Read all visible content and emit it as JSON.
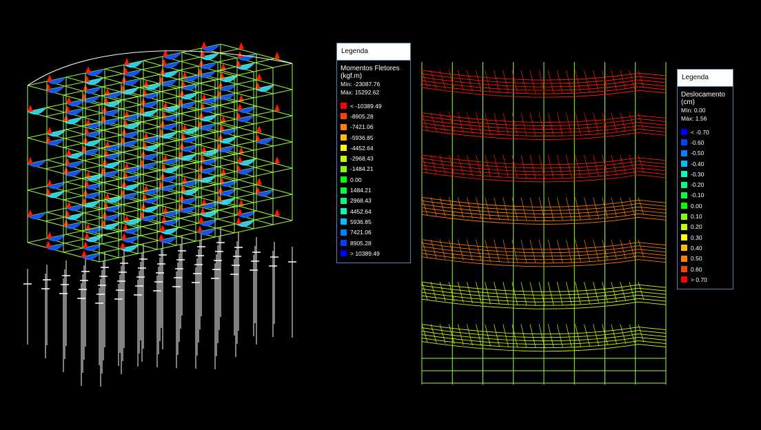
{
  "legend_momentos": {
    "header": "Legenda",
    "title": "Momentos Fletores\n(kgf.m)",
    "min": "Mín: -23087.76",
    "max": "Máx: 15292.62",
    "items": [
      {
        "label": "< -10389.49",
        "color": "#ff0000"
      },
      {
        "label": "-8905.28",
        "color": "#ff4000"
      },
      {
        "label": "-7421.06",
        "color": "#ff8000"
      },
      {
        "label": "-5936.85",
        "color": "#ffbf00"
      },
      {
        "label": "-4452.64",
        "color": "#ffff00"
      },
      {
        "label": "-2968.43",
        "color": "#bfff00"
      },
      {
        "label": "-1484.21",
        "color": "#80ff00"
      },
      {
        "label": "0.00",
        "color": "#00ff00"
      },
      {
        "label": "1484.21",
        "color": "#00ff40"
      },
      {
        "label": "2968.43",
        "color": "#00ff80"
      },
      {
        "label": "4452.64",
        "color": "#00ffbf"
      },
      {
        "label": "5936.85",
        "color": "#00bfff"
      },
      {
        "label": "7421.06",
        "color": "#0080ff"
      },
      {
        "label": "8905.28",
        "color": "#0040ff"
      },
      {
        "label": "> 10389.49",
        "color": "#0000ff"
      }
    ]
  },
  "legend_deslocamento": {
    "header": "Legenda",
    "title": "Deslocamento\n(cm)",
    "min": "Mín: 0.00",
    "max": "Máx: 1.56",
    "items": [
      {
        "label": "< -0.70",
        "color": "#0000ff"
      },
      {
        "label": "-0.60",
        "color": "#0040ff"
      },
      {
        "label": "-0.50",
        "color": "#0080ff"
      },
      {
        "label": "-0.40",
        "color": "#00bfff"
      },
      {
        "label": "-0.30",
        "color": "#00ffbf"
      },
      {
        "label": "-0.20",
        "color": "#00ff80"
      },
      {
        "label": "-0.10",
        "color": "#00ff40"
      },
      {
        "label": "0.00",
        "color": "#00ff00"
      },
      {
        "label": "0.10",
        "color": "#80ff00"
      },
      {
        "label": "0.20",
        "color": "#bfff00"
      },
      {
        "label": "0.30",
        "color": "#ffff00"
      },
      {
        "label": "0.40",
        "color": "#ffbf00"
      },
      {
        "label": "0.50",
        "color": "#ff8000"
      },
      {
        "label": "0.60",
        "color": "#ff4000"
      },
      {
        "label": "> 0.70",
        "color": "#ff0000"
      }
    ]
  },
  "colors": {
    "background": "#000000",
    "frame_green": "#9cff3a",
    "column_white": "#ffffff",
    "moment_blue": "#1a5cff",
    "moment_cyan": "#36e0ff",
    "moment_red": "#ff1a00",
    "mesh_red": "#ff1a00",
    "mesh_orange": "#ff7a00",
    "mesh_yellow": "#d8ff00"
  }
}
